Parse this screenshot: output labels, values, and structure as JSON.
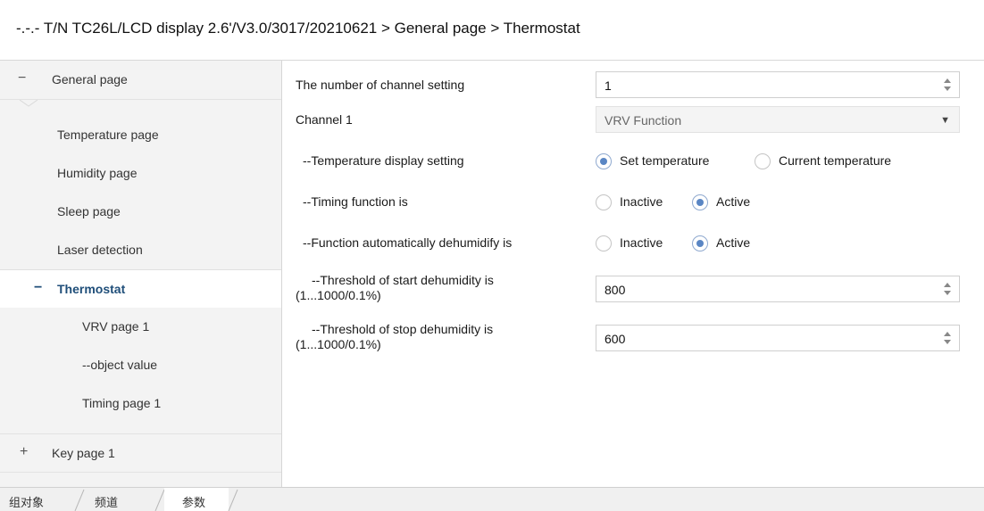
{
  "window": {
    "breadcrumb": "-.-.- T/N TC26L/LCD display 2.6'/V3.0/3017/20210621 > General page > Thermostat"
  },
  "sidebar": {
    "general_sign": "−",
    "general_label": "General page",
    "items": [
      {
        "label": "Temperature page"
      },
      {
        "label": "Humidity page"
      },
      {
        "label": "Sleep page"
      },
      {
        "label": "Laser detection"
      }
    ],
    "thermostat_sign": "−",
    "thermostat_label": "Thermostat",
    "sub_items": [
      {
        "label": "VRV page 1"
      },
      {
        "label": "--object value"
      },
      {
        "label": "Timing page 1"
      }
    ],
    "key_sign": "+",
    "key_label": "Key page 1"
  },
  "params": {
    "channel_count": {
      "label": "The number of channel setting",
      "value": "1"
    },
    "channel1": {
      "label": "Channel 1",
      "value": "VRV Function"
    },
    "temp_display": {
      "label": "--Temperature display setting",
      "options": [
        "Set temperature",
        "Current temperature"
      ],
      "selected": "Set temperature"
    },
    "timing": {
      "label": "--Timing function is",
      "options": [
        "Inactive",
        "Active"
      ],
      "selected": "Active"
    },
    "dehumidify": {
      "label": "--Function automatically dehumidify is",
      "options": [
        "Inactive",
        "Active"
      ],
      "selected": "Active"
    },
    "start_threshold": {
      "label_line1": "--Threshold of start dehumidity is",
      "label_line2": "(1...1000/0.1%)",
      "value": "800"
    },
    "stop_threshold": {
      "label_line1": "--Threshold of stop dehumidity is",
      "label_line2": "(1...1000/0.1%)",
      "value": "600"
    }
  },
  "bottom_tabs": [
    "组对象",
    "频道",
    "参数"
  ],
  "colors": {
    "accent": "#1f4e79",
    "radio_checked": "#5a86c4"
  }
}
